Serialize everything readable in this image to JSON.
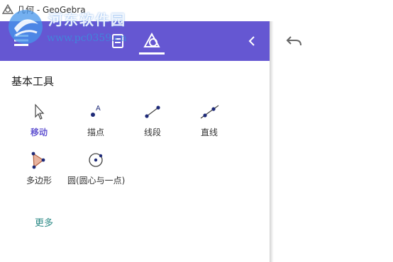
{
  "window": {
    "title": "几何 - GeoGebra"
  },
  "watermark": {
    "site_name": "河东软件园",
    "url": "www.pc0359.cn"
  },
  "toolbar": {
    "tabs": [
      {
        "icon": "menu-icon"
      },
      {
        "icon": "algebra-icon"
      },
      {
        "icon": "tools-icon",
        "active": true
      }
    ],
    "accent_color": "#6557d2"
  },
  "tools_panel": {
    "section_title": "基本工具",
    "tools": [
      {
        "label": "移动",
        "icon": "cursor-move-icon",
        "active": true
      },
      {
        "label": "描点",
        "icon": "point-icon"
      },
      {
        "label": "线段",
        "icon": "segment-icon"
      },
      {
        "label": "直线",
        "icon": "line-icon"
      },
      {
        "label": "多边形",
        "icon": "polygon-icon"
      },
      {
        "label": "圆(圆心与一点)",
        "icon": "circle-center-point-icon"
      }
    ],
    "more_label": "更多"
  },
  "graphics_view": {
    "undo_icon": "undo-icon"
  }
}
